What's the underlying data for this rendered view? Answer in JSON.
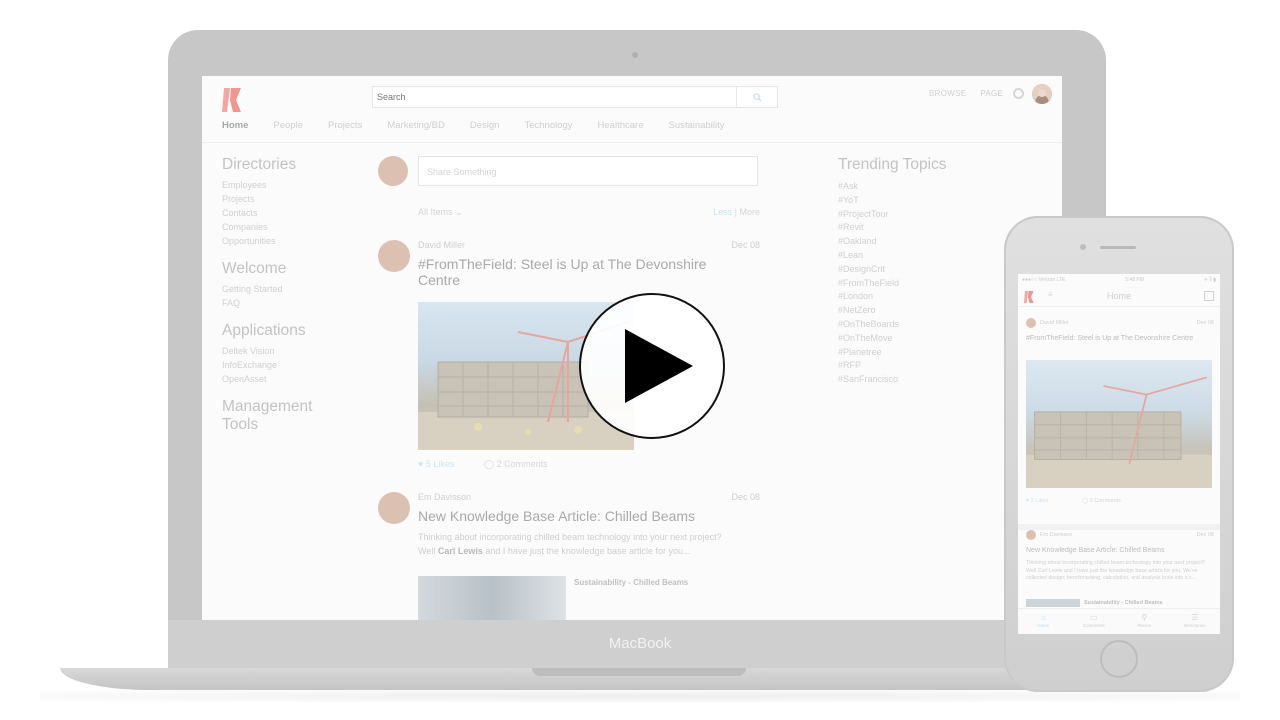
{
  "laptop": {
    "brand": "MacBook",
    "app": {
      "search_placeholder": "Search",
      "top_links": [
        "BROWSE",
        "PAGE"
      ],
      "nav": [
        "Home",
        "People",
        "Projects",
        "Marketing/BD",
        "Design",
        "Technology",
        "Healthcare",
        "Sustainability"
      ],
      "left": {
        "directories_title": "Directories",
        "directories": [
          "Employees",
          "Projects",
          "Contacts",
          "Companies",
          "Opportunities"
        ],
        "welcome_title": "Welcome",
        "welcome": [
          "Getting Started",
          "FAQ"
        ],
        "applications_title": "Applications",
        "applications": [
          "Deltek Vision",
          "InfoExchange",
          "OpenAsset"
        ],
        "management_title": "Management Tools"
      },
      "composer_placeholder": "Share Something",
      "filter": "All Items",
      "less": "Less",
      "more": "More",
      "posts": [
        {
          "author": "David Miller",
          "date": "Dec 08",
          "title": "#FromTheField: Steel is Up at The Devonshire Centre",
          "likes": "5 Likes",
          "comments": "2 Comments"
        },
        {
          "author": "Em Davisson",
          "date": "Dec 08",
          "title": "New Knowledge Base Article: Chilled Beams",
          "excerpt_pre": "Thinking about incorporating chilled beam technology into your next project? Well ",
          "excerpt_name": "Carl Lewis",
          "excerpt_post": " and I have just the knowledge base article for you...",
          "attachment_label": "Sustainability - Chilled Beams"
        }
      ],
      "trending_title": "Trending Topics",
      "trending": [
        "#Ask",
        "#YoT",
        "#ProjectTour",
        "#Revit",
        "#Oakland",
        "#Lean",
        "#DesignCrit",
        "#FromTheField",
        "#London",
        "#NetZero",
        "#OnTheBoards",
        "#OnTheMove",
        "#Planetree",
        "#RFP",
        "#SanFrancisco"
      ]
    }
  },
  "phone": {
    "status_left": "●●●○○ Verizon  LTE",
    "status_time": "5:48 PM",
    "status_right": "✈ ⁑ ▮",
    "title": "Home",
    "post1_author": "David Miller",
    "post1_date": "Dec 08",
    "post1_title": "#FromTheField: Steel is Up at The Devonshire Centre",
    "post1_likes": "3 Likes",
    "post1_comments": "2 Comments",
    "post2_author": "Em Davisson",
    "post2_date": "Dec 08",
    "post2_title": "New Knowledge Base Article: Chilled Beams",
    "post2_excerpt": "Thinking about incorporating chilled beam technology into your next project? Well Carl Lewis and I have just the knowledge base article for you. We've collected design, benchmarking, calculation, and analysis tools into a c...",
    "post2_tag": "Sustainability - Chilled Beams",
    "tabs": [
      "Home",
      "Comments",
      "Places",
      "Directories"
    ]
  }
}
